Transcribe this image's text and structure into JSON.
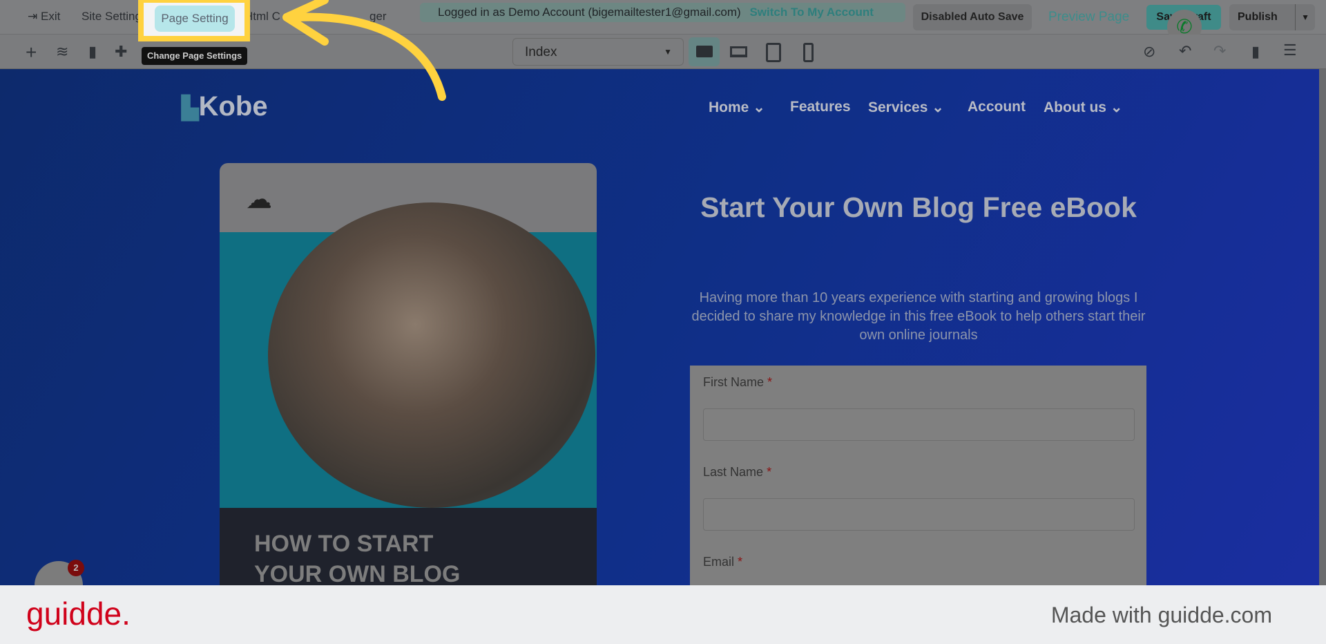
{
  "topbar": {
    "exit": "Exit",
    "site_settings": "Site Setting",
    "page_setting": "Page Setting",
    "html_code": "Html C",
    "manager": "ger",
    "logged_in": "Logged in as Demo Account (bigemailtester1@gmail.com)",
    "switch": "Switch To My Account",
    "auto_save": "Disabled Auto Save",
    "preview": "Preview Page",
    "save_draft": "Save Draft",
    "publish": "Publish"
  },
  "toolbar": {
    "tooltip": "Change Page Settings",
    "page_select": "Index"
  },
  "site": {
    "logo": "Kobe",
    "nav": [
      "Home",
      "Features",
      "Services",
      "Account",
      "About us"
    ],
    "heading": "Start Your Own Blog Free eBook",
    "paragraph": "Having more than 10 years experience with starting and growing blogs I decided to share my knowledge in this free eBook to help others start their own online journals",
    "card_title_1": "HOW TO START",
    "card_title_2": "YOUR OWN BLOG",
    "form": {
      "first_name": "First Name",
      "last_name": "Last Name",
      "email": "Email",
      "required": "*"
    }
  },
  "chat": {
    "badge": "2"
  },
  "footer": {
    "brand": "guidde.",
    "made_with": "Made with guidde.com"
  },
  "colors": {
    "highlight": "#ffd23f",
    "brand_red": "#d0021b",
    "teal": "#5fa8a8"
  }
}
